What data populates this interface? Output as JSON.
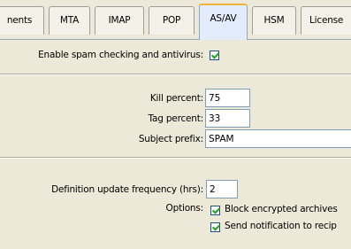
{
  "tabs": [
    {
      "label": "nents",
      "active": false
    },
    {
      "label": "MTA",
      "active": false
    },
    {
      "label": "IMAP",
      "active": false
    },
    {
      "label": "POP",
      "active": false
    },
    {
      "label": "AS/AV",
      "active": true
    },
    {
      "label": "HSM",
      "active": false
    },
    {
      "label": "License",
      "active": false
    }
  ],
  "spam": {
    "enable_label": "Enable spam checking and antivirus:",
    "enable_checked": true
  },
  "kill_percent": {
    "label": "Kill percent:",
    "value": "75"
  },
  "tag_percent": {
    "label": "Tag percent:",
    "value": "33"
  },
  "subject_prefix": {
    "label": "Subject prefix:",
    "value": "SPAM"
  },
  "definition_update": {
    "label": "Definition update frequency (hrs):",
    "value": "2"
  },
  "options": {
    "label": "Options:",
    "items": [
      {
        "label": "Block encrypted archives",
        "checked": true
      },
      {
        "label": "Send notification to recip",
        "checked": true
      }
    ]
  },
  "colors": {
    "panel_bg": "#ece9d8",
    "active_tab_bg": "#e2ecfa",
    "active_tab_accent": "#f2b33d",
    "check_color": "#21a121"
  }
}
